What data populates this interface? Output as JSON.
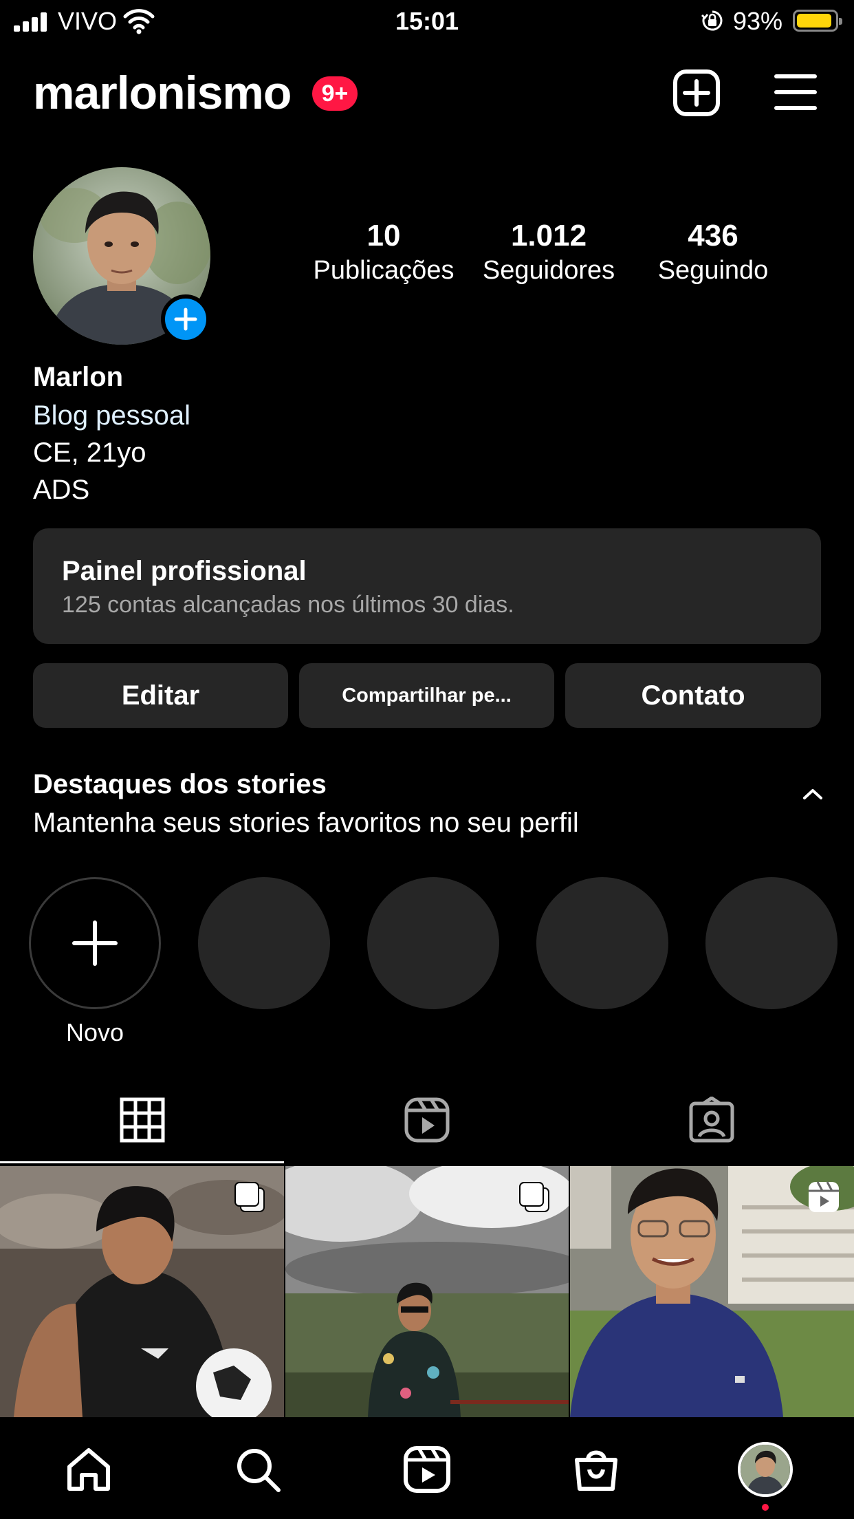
{
  "status_bar": {
    "carrier": "VIVO",
    "time": "15:01",
    "battery_percent": "93%",
    "battery_level": 0.93,
    "battery_color": "#ffd60a",
    "icons": [
      "signal-icon",
      "wifi-icon",
      "orientation-lock-icon",
      "battery-icon"
    ]
  },
  "header": {
    "username": "marlonismo",
    "notification_badge": "9+",
    "badge_color": "#ff1744",
    "icons": [
      "new-post-icon",
      "menu-icon"
    ]
  },
  "profile": {
    "stats": [
      {
        "value": "10",
        "label": "Publicações"
      },
      {
        "value": "1.012",
        "label": "Seguidores"
      },
      {
        "value": "436",
        "label": "Seguindo"
      }
    ],
    "name": "Marlon",
    "category": "Blog pessoal",
    "bio_lines": [
      "CE, 21yo",
      "ADS"
    ],
    "category_color": "#e0f1ff",
    "add_story_color": "#0095f6"
  },
  "professional_panel": {
    "title": "Painel profissional",
    "subtitle": "125 contas alcançadas nos últimos 30 dias."
  },
  "buttons": {
    "edit": "Editar",
    "share": "Compartilhar pe...",
    "contact": "Contato"
  },
  "highlights": {
    "title": "Destaques dos stories",
    "subtitle": "Mantenha seus stories favoritos no seu perfil",
    "new_label": "Novo",
    "placeholder_count": 4
  },
  "tabs": {
    "items": [
      "grid-icon",
      "reels-icon",
      "tagged-icon"
    ],
    "active": "grid-icon"
  },
  "posts": [
    {
      "type": "carousel",
      "icon": "carousel-icon"
    },
    {
      "type": "carousel",
      "icon": "carousel-icon"
    },
    {
      "type": "reel",
      "icon": "reels-icon"
    }
  ],
  "bottom_nav": {
    "items": [
      "home-icon",
      "search-icon",
      "reels-icon",
      "shop-icon",
      "profile-avatar"
    ],
    "notification_dot_color": "#ff1744"
  }
}
